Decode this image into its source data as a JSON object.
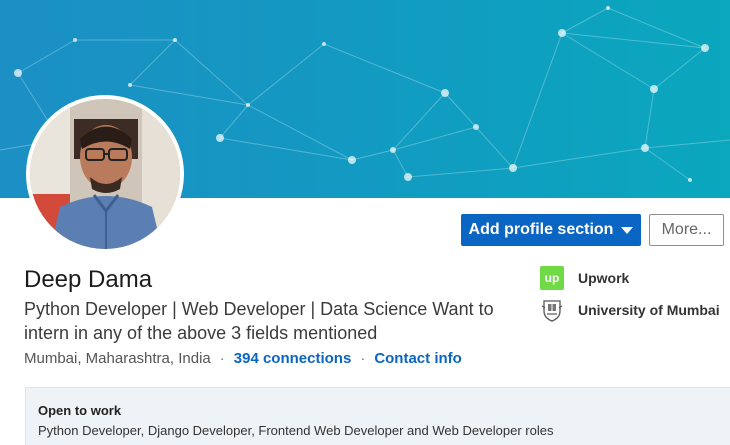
{
  "profile": {
    "name": "Deep Dama",
    "headline": "Python Developer | Web Developer | Data Science Want to intern in any of the above 3 fields mentioned",
    "location": "Mumbai, Maharashtra, India",
    "separator": "·",
    "connections": "394 connections",
    "contact": "Contact info"
  },
  "actions": {
    "add_section": "Add profile section",
    "more": "More..."
  },
  "experience": [
    {
      "name": "Upwork",
      "logo": "upwork-logo",
      "logo_text": "up"
    },
    {
      "name": "University of Mumbai",
      "logo": "university-crest-logo"
    }
  ],
  "open_to_work": {
    "title": "Open to work",
    "roles": "Python Developer, Django Developer, Frontend Web Developer and Web Developer roles"
  },
  "colors": {
    "brand": "#0a66c2",
    "banner_start": "#1c8fc4",
    "banner_end": "#0aa7bd",
    "upwork": "#6fda44"
  }
}
